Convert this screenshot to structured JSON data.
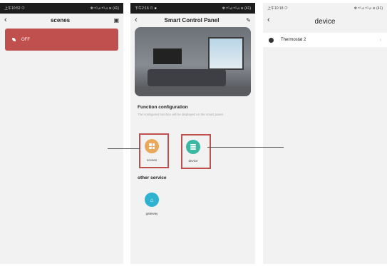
{
  "left_panel": {
    "status_time": "上午10:52 ⊙",
    "status_icons": "✻ ⁵ᴳ⊿ ⁵ᴳ⊿ ≋ (41)",
    "nav_title": "scenes",
    "back_icon": "chevron-left-icon",
    "tool_icon": "settings-icon",
    "scene_label": "OFF"
  },
  "middle_panel": {
    "status_time": "下午2:16 ⊙ ■",
    "status_icons": "✻ ⁵ᴳ⊿ ⁵ᴳ⊿ ≋ (41)",
    "nav_title": "Smart Control Panel",
    "function_title": "Function configuration",
    "function_desc": "The configured function will be displayed on the smart panel",
    "scenes_label": "scenes",
    "device_label": "device",
    "other_title": "other service",
    "gateway_label": "gateway",
    "colors": {
      "scenes": "#e8a95a",
      "device": "#3bb8a2",
      "gateway": "#2fb2cf",
      "highlight": "#c0504d"
    }
  },
  "right_panel": {
    "status_time": "上午10:18 ⊙",
    "status_icons": "✻ ⁵ᴳ⊿ ⁵ᴳ⊿ ≋ (41)",
    "title": "device",
    "device_name": "Thermostat 2"
  }
}
